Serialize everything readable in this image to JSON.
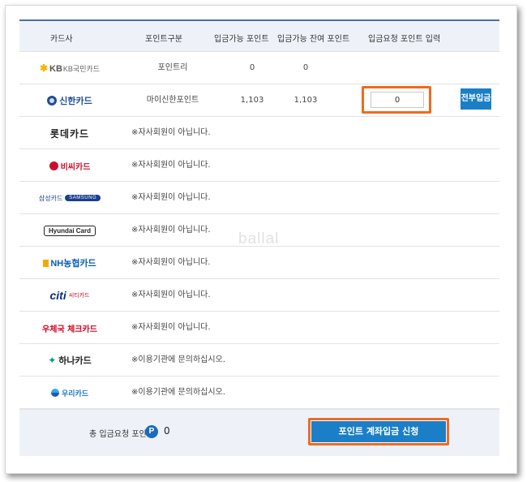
{
  "table": {
    "headers": {
      "card": "카드사",
      "type": "포인트구분",
      "available": "입금가능 포인트",
      "remaining": "입금가능 잔여 포인트",
      "request": "입금요청 포인트 입력"
    },
    "rows": [
      {
        "card": "KB국민카드",
        "type": "포인트리",
        "available": "0",
        "remaining": "0"
      },
      {
        "card": "신한카드",
        "type": "마이신한포인트",
        "available": "1,103",
        "remaining": "1,103",
        "input_value": "0",
        "button": "전부입금"
      },
      {
        "card": "롯데카드",
        "notice": "※자사회원이 아닙니다."
      },
      {
        "card": "비씨카드",
        "notice": "※자사회원이 아닙니다."
      },
      {
        "card": "삼성카드",
        "card_en": "SAMSUNG",
        "notice": "※자사회원이 아닙니다."
      },
      {
        "card": "Hyundai Card",
        "notice": "※자사회원이 아닙니다."
      },
      {
        "card": "NH농협카드",
        "notice": "※자사회원이 아닙니다."
      },
      {
        "card_en": "citi",
        "card": "씨티카드",
        "notice": "※자사회원이 아닙니다."
      },
      {
        "card": "우체국 체크카드",
        "notice": "※자사회원이 아닙니다."
      },
      {
        "card": "하나카드",
        "notice": "※이용기관에 문의하십시오."
      },
      {
        "card": "우리카드",
        "notice": "※이용기관에 문의하십시오."
      }
    ]
  },
  "watermark": "ballal",
  "footer": {
    "label": "총 입금요청 포인트",
    "badge": "P",
    "total": "0",
    "submit_label": "포인트 계좌입금 신청"
  },
  "colors": {
    "accent_blue": "#1b7fc8",
    "highlight_orange": "#f06a20",
    "header_bg": "#eef2f8"
  }
}
